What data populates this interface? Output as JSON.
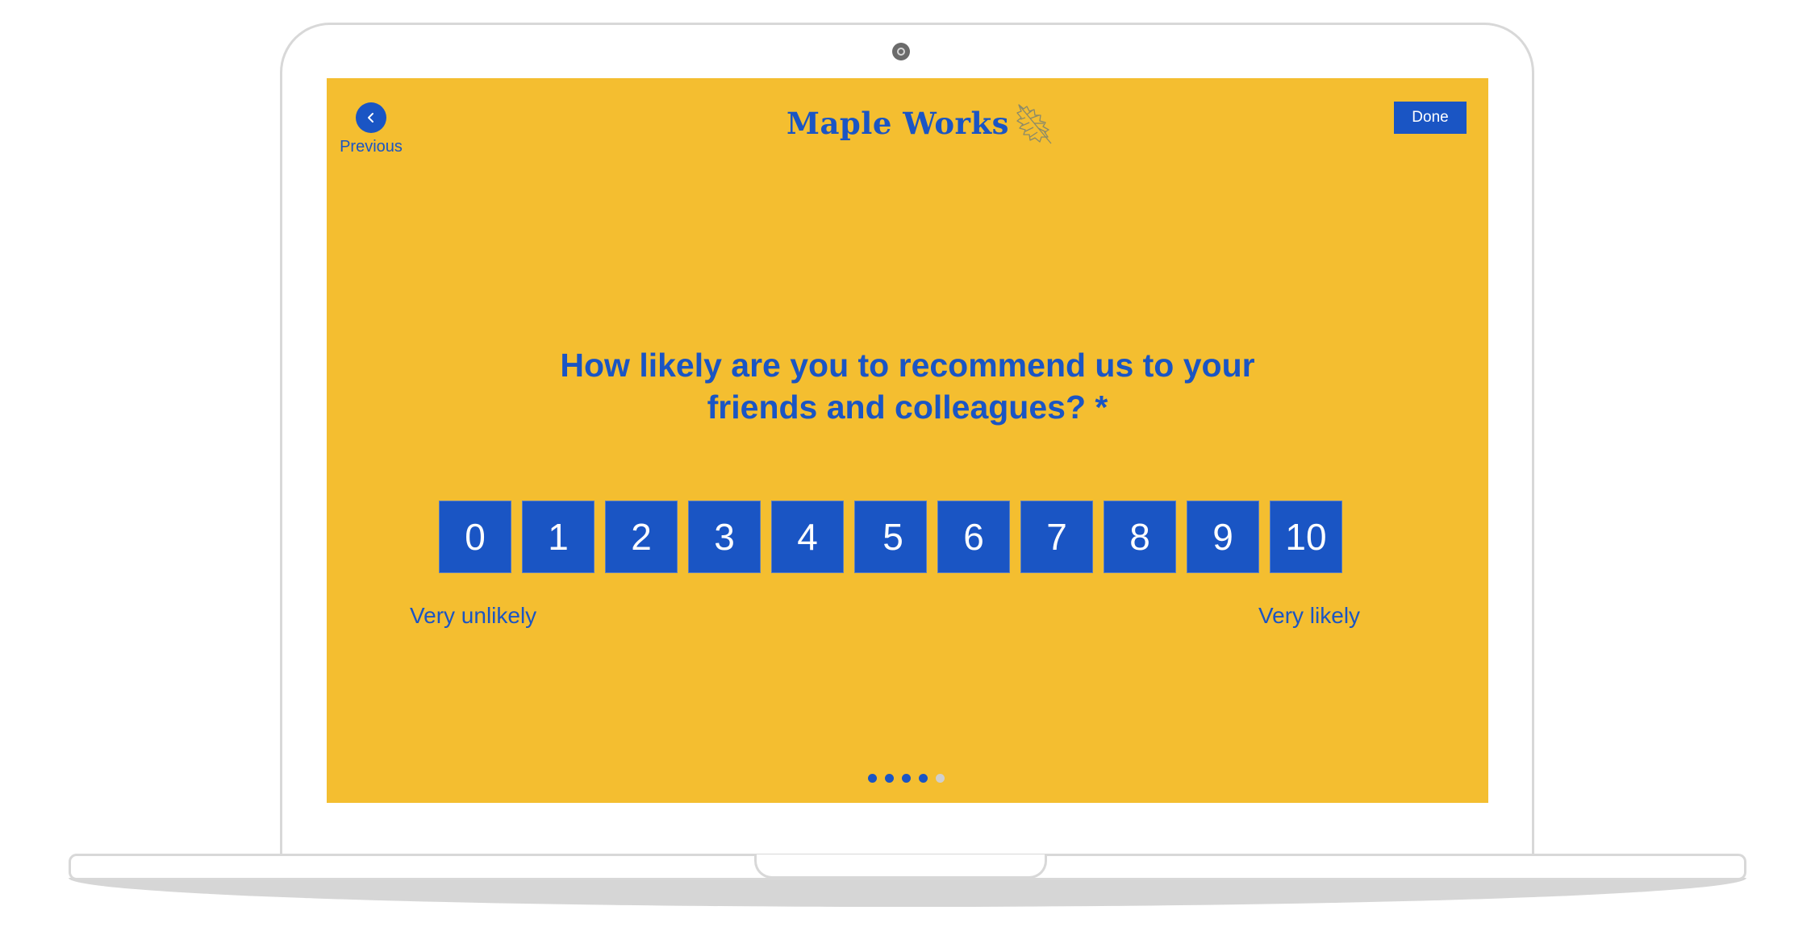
{
  "header": {
    "previous_label": "Previous",
    "previous_icon": "chevron-left-icon",
    "logo_text": "Maple Works",
    "logo_icon": "maple-leaf-icon",
    "done_label": "Done"
  },
  "question": {
    "line1": "How likely are you to recommend us to your",
    "line2": "friends and colleagues? *",
    "required": true
  },
  "scale": {
    "options": [
      "0",
      "1",
      "2",
      "3",
      "4",
      "5",
      "6",
      "7",
      "8",
      "9",
      "10"
    ],
    "low_label": "Very unlikely",
    "high_label": "Very likely"
  },
  "pagination": {
    "total": 5,
    "current": 4
  },
  "colors": {
    "background": "#F4BE30",
    "accent": "#1A55C4",
    "inactive_dot": "#cfcfcf"
  }
}
